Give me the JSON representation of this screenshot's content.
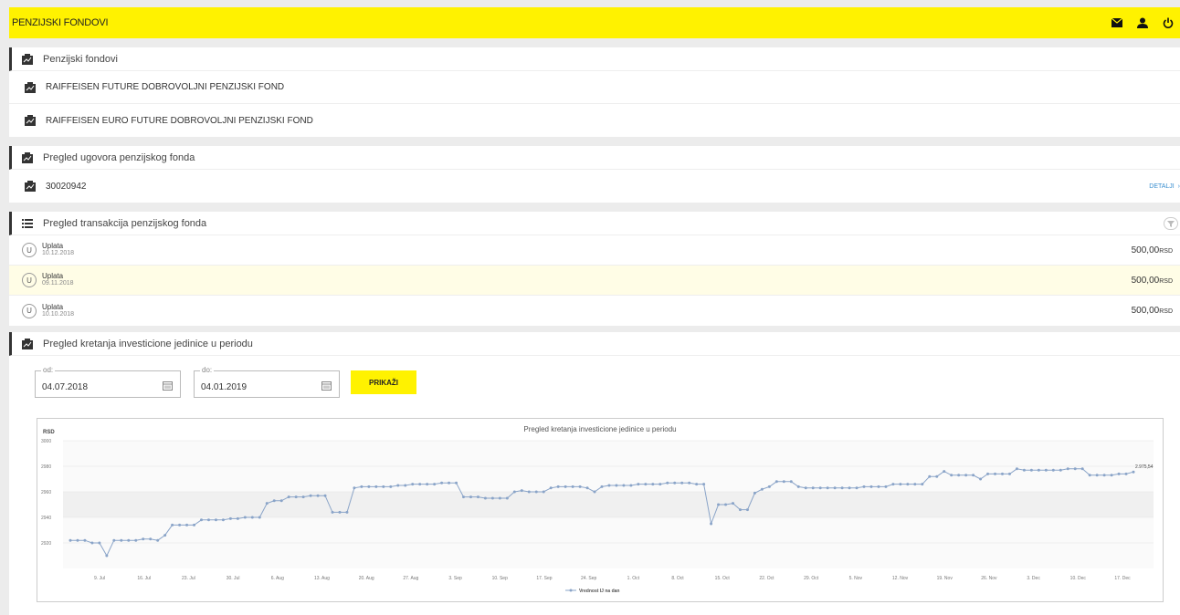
{
  "header": {
    "title": "PENZIJSKI FONDOVI",
    "icons": [
      "mail-icon",
      "user-icon",
      "power-icon"
    ]
  },
  "funds": {
    "title": "Penzijski fondovi",
    "items": [
      "RAIFFEISEN FUTURE DOBROVOLJNI PENZIJSKI FOND",
      "RAIFFEISEN EURO FUTURE DOBROVOLJNI PENZIJSKI FOND"
    ]
  },
  "contract": {
    "title": "Pregled ugovora penzijskog fonda",
    "number": "30020942",
    "details_label": "DETALJI"
  },
  "transactions": {
    "title": "Pregled transakcija penzijskog fonda",
    "items": [
      {
        "badge": "U",
        "name": "Uplata",
        "date": "10.12.2018",
        "amount": "500,00",
        "currency": "RSD"
      },
      {
        "badge": "U",
        "name": "Uplata",
        "date": "09.11.2018",
        "amount": "500,00",
        "currency": "RSD"
      },
      {
        "badge": "U",
        "name": "Uplata",
        "date": "10.10.2018",
        "amount": "500,00",
        "currency": "RSD"
      }
    ]
  },
  "units": {
    "title": "Pregled kretanja investicione jedinice u periodu",
    "from_label": "od:",
    "from_value": "04.07.2018",
    "to_label": "do:",
    "to_value": "04.01.2019",
    "button": "PRIKAŽI"
  },
  "colors": {
    "brand": "#fff200",
    "line": "#8aa4c8",
    "link": "#3a8fd0"
  },
  "chart_data": {
    "type": "line",
    "title": "Pregled kretanja investicione jedinice u periodu",
    "ylabel": "RSD",
    "ylim": [
      2900,
      3000
    ],
    "yticks": [
      2920,
      2940,
      2960,
      2980,
      3000
    ],
    "xticks": [
      "9. Jul",
      "16. Jul",
      "23. Jul",
      "30. Jul",
      "6. Aug",
      "13. Aug",
      "20. Aug",
      "27. Aug",
      "3. Sep",
      "10. Sep",
      "17. Sep",
      "24. Sep",
      "1. Oct",
      "8. Oct",
      "15. Oct",
      "22. Oct",
      "29. Oct",
      "5. Nov",
      "12. Nov",
      "19. Nov",
      "26. Nov",
      "3. Dec",
      "10. Dec",
      "17. Dec"
    ],
    "last_label": "2.975,54",
    "legend": "Vrednost IJ na dan",
    "series": [
      {
        "name": "Vrednost IJ na dan",
        "values": [
          2922,
          2922,
          2922,
          2920,
          2920,
          2910,
          2922,
          2922,
          2922,
          2922,
          2923,
          2923,
          2922,
          2926,
          2934,
          2934,
          2934,
          2934,
          2938,
          2938,
          2938,
          2938,
          2939,
          2939,
          2940,
          2940,
          2940,
          2951,
          2953,
          2953,
          2956,
          2956,
          2956,
          2957,
          2957,
          2957,
          2944,
          2944,
          2944,
          2963,
          2964,
          2964,
          2964,
          2964,
          2964,
          2965,
          2965,
          2966,
          2966,
          2966,
          2966,
          2967,
          2967,
          2967,
          2956,
          2956,
          2956,
          2955,
          2955,
          2955,
          2955,
          2960,
          2961,
          2960,
          2960,
          2960,
          2963,
          2964,
          2964,
          2964,
          2964,
          2963,
          2960,
          2964,
          2965,
          2965,
          2965,
          2965,
          2966,
          2966,
          2966,
          2966,
          2967,
          2967,
          2967,
          2967,
          2966,
          2966,
          2935,
          2950,
          2950,
          2951,
          2946,
          2946,
          2959,
          2962,
          2964,
          2968,
          2968,
          2968,
          2964,
          2963,
          2963,
          2963,
          2963,
          2963,
          2963,
          2963,
          2963,
          2964,
          2964,
          2964,
          2964,
          2966,
          2966,
          2966,
          2966,
          2966,
          2972,
          2972,
          2976,
          2973,
          2973,
          2973,
          2973,
          2970,
          2974,
          2974,
          2974,
          2974,
          2978,
          2977,
          2977,
          2977,
          2977,
          2977,
          2977,
          2978,
          2978,
          2978,
          2973,
          2973,
          2973,
          2973,
          2974,
          2974,
          2975.54
        ]
      }
    ]
  }
}
